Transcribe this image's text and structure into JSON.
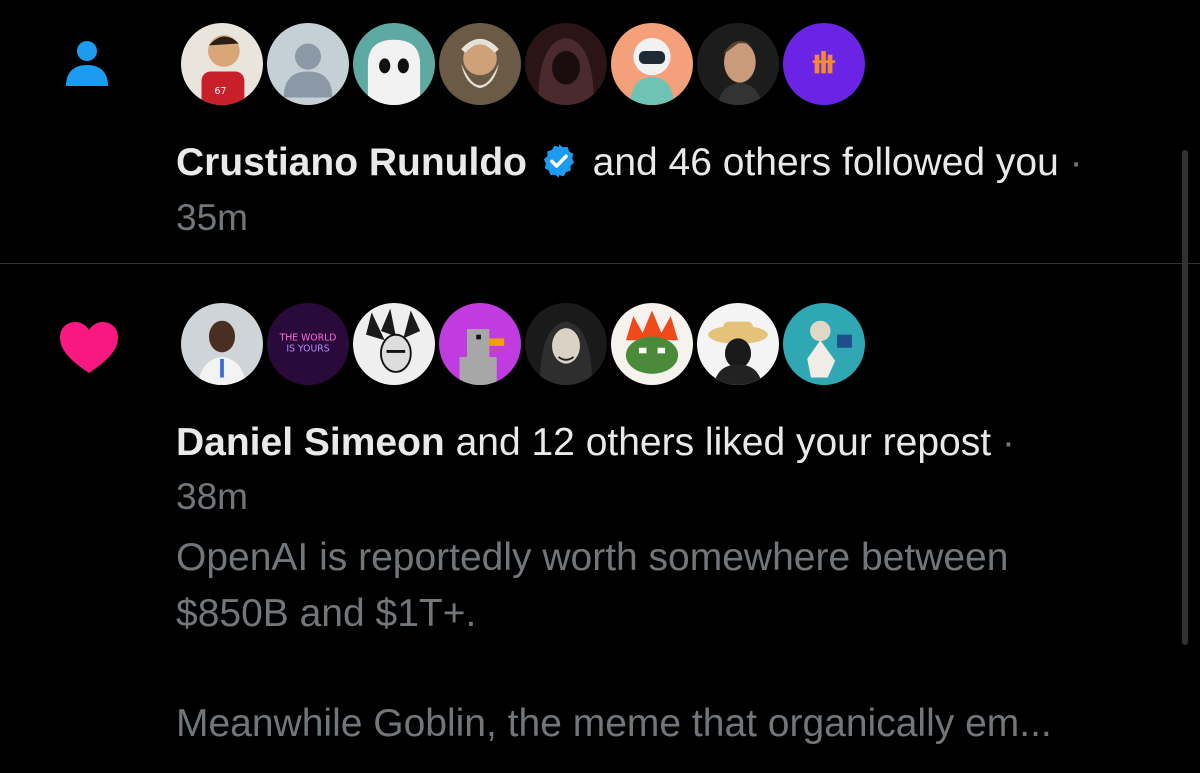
{
  "notifications": [
    {
      "type_icon": "person-icon",
      "avatars": [
        "avatar-soccer-cartoon",
        "avatar-default",
        "avatar-ghost",
        "avatar-old-man",
        "avatar-hooded-figure",
        "avatar-robot-astronaut",
        "avatar-man-portrait",
        "avatar-purple-logo"
      ],
      "name": "Crustiano Runuldo",
      "verified": true,
      "action": "and 46 others followed you",
      "separator": "·",
      "time": "35m"
    },
    {
      "type_icon": "heart-icon",
      "avatars": [
        "avatar-man-photo",
        "avatar-neon-sign",
        "avatar-manga-sketch",
        "avatar-pixel-duck",
        "avatar-masked-figure",
        "avatar-pixel-frog",
        "avatar-straw-hat",
        "avatar-anime-art"
      ],
      "avatar_text": "THE WORLD\nIS YOURS",
      "name": "Daniel Simeon",
      "verified": false,
      "action": "and 12 others liked your repost",
      "separator": "·",
      "time": "38m",
      "post_lines": [
        "OpenAI is reportedly worth somewhere between",
        "$850B and $1T+.",
        "Meanwhile Goblin, the meme that organically em..."
      ]
    }
  ],
  "colors": {
    "background": "#000000",
    "primary_text": "#e7e9ea",
    "secondary_text": "#71767b",
    "accent_blue": "#1d9bf0",
    "like_pink": "#f91880",
    "divider": "#2f3336"
  }
}
